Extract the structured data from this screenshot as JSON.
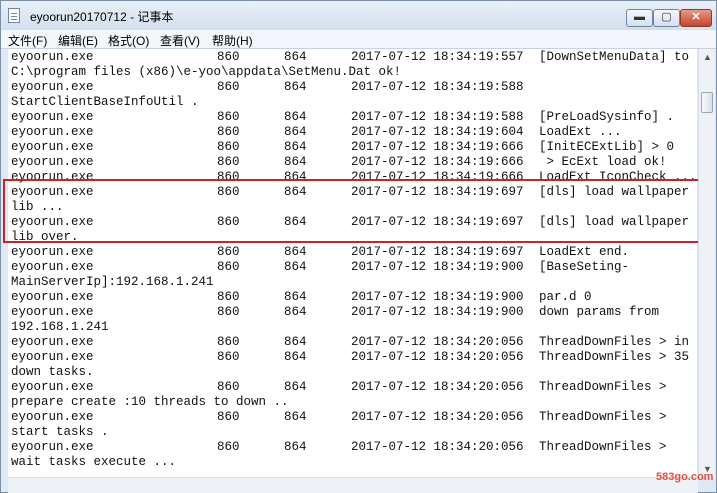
{
  "window": {
    "title": "eyoorun20170712 - 记事本"
  },
  "controls": {
    "minimize": "▬",
    "maximize": "▢",
    "close": "✕"
  },
  "menu": [
    "文件(F)",
    "编辑(E)",
    "格式(O)",
    "查看(V)",
    "帮助(H)"
  ],
  "log_lines": [
    [
      "eyoorun.exe",
      "860",
      "864",
      "2017-07-12 18:34:19:557",
      "[DownSetMenuData] to"
    ],
    [
      "C:\\program files (x86)\\e-yoo\\appdata\\SetMenu.Dat ok!",
      "",
      "",
      "",
      ""
    ],
    [
      "eyoorun.exe",
      "860",
      "864",
      "2017-07-12 18:34:19:588",
      ""
    ],
    [
      "StartClientBaseInfoUtil .",
      "",
      "",
      "",
      ""
    ],
    [
      "eyoorun.exe",
      "860",
      "864",
      "2017-07-12 18:34:19:588",
      "[PreLoadSysinfo] ."
    ],
    [
      "eyoorun.exe",
      "860",
      "864",
      "2017-07-12 18:34:19:604",
      "LoadExt ..."
    ],
    [
      "eyoorun.exe",
      "860",
      "864",
      "2017-07-12 18:34:19:666",
      "[InitECExtLib] > 0"
    ],
    [
      "eyoorun.exe",
      "860",
      "864",
      "2017-07-12 18:34:19:666",
      " > EcExt load ok!"
    ],
    [
      "eyoorun.exe",
      "860",
      "864",
      "2017-07-12 18:34:19:666",
      "LoadExt IconCheck ..."
    ],
    [
      "eyoorun.exe",
      "860",
      "864",
      "2017-07-12 18:34:19:697",
      "[dls] load wallpaper"
    ],
    [
      "lib ...",
      "",
      "",
      "",
      ""
    ],
    [
      "eyoorun.exe",
      "860",
      "864",
      "2017-07-12 18:34:19:697",
      "[dls] load wallpaper"
    ],
    [
      "lib over.",
      "",
      "",
      "",
      ""
    ],
    [
      "eyoorun.exe",
      "860",
      "864",
      "2017-07-12 18:34:19:697",
      "LoadExt end."
    ],
    [
      "eyoorun.exe",
      "860",
      "864",
      "2017-07-12 18:34:19:900",
      "[BaseSeting-"
    ],
    [
      "MainServerIp]:192.168.1.241",
      "",
      "",
      "",
      ""
    ],
    [
      "eyoorun.exe",
      "860",
      "864",
      "2017-07-12 18:34:19:900",
      "par.d 0"
    ],
    [
      "eyoorun.exe",
      "860",
      "864",
      "2017-07-12 18:34:19:900",
      "down params from"
    ],
    [
      "192.168.1.241",
      "",
      "",
      "",
      ""
    ],
    [
      "eyoorun.exe",
      "860",
      "864",
      "2017-07-12 18:34:20:056",
      "ThreadDownFiles > in"
    ],
    [
      "eyoorun.exe",
      "860",
      "864",
      "2017-07-12 18:34:20:056",
      "ThreadDownFiles > 35"
    ],
    [
      "down tasks.",
      "",
      "",
      "",
      ""
    ],
    [
      "eyoorun.exe",
      "860",
      "864",
      "2017-07-12 18:34:20:056",
      "ThreadDownFiles >"
    ],
    [
      "prepare create :10 threads to down ..",
      "",
      "",
      "",
      ""
    ],
    [
      "eyoorun.exe",
      "860",
      "864",
      "2017-07-12 18:34:20:056",
      "ThreadDownFiles >"
    ],
    [
      "start tasks .",
      "",
      "",
      "",
      ""
    ],
    [
      "eyoorun.exe",
      "860",
      "864",
      "2017-07-12 18:34:20:056",
      "ThreadDownFiles >"
    ],
    [
      "wait tasks execute ...",
      "",
      "",
      "",
      ""
    ]
  ],
  "scrollbar_arrows": {
    "up": "▲",
    "down": "▼"
  },
  "watermark": "583go.com",
  "colors": {
    "highlight": "#c9242b",
    "watermark": "#e34f43"
  }
}
